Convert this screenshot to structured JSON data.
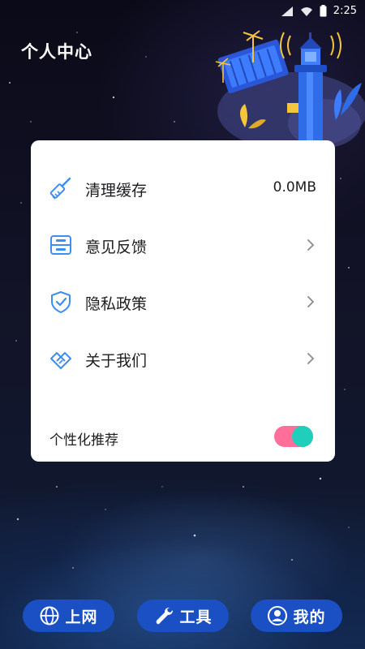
{
  "status_bar": {
    "time": "2:25",
    "icons": [
      "signal-icon",
      "wifi-icon",
      "battery-icon"
    ]
  },
  "header": {
    "title": "个人中心"
  },
  "settings": {
    "items": [
      {
        "label": "清理缓存",
        "value": "0.0MB",
        "icon": "broom-icon"
      },
      {
        "label": "意见反馈",
        "icon": "feedback-icon"
      },
      {
        "label": "隐私政策",
        "icon": "shield-check-icon"
      },
      {
        "label": "关于我们",
        "icon": "handshake-icon"
      }
    ],
    "recommend": {
      "label": "个性化推荐",
      "enabled": true
    }
  },
  "tabbar": {
    "tabs": [
      {
        "label": "上网",
        "icon": "globe-icon"
      },
      {
        "label": "工具",
        "icon": "wrench-icon"
      },
      {
        "label": "我的",
        "icon": "user-icon"
      }
    ]
  },
  "colors": {
    "accent": "#1b4fc4",
    "icon_blue": "#3d8ef0",
    "toggle_track": "#ff6f9a",
    "toggle_knob": "#1fcfbb"
  }
}
